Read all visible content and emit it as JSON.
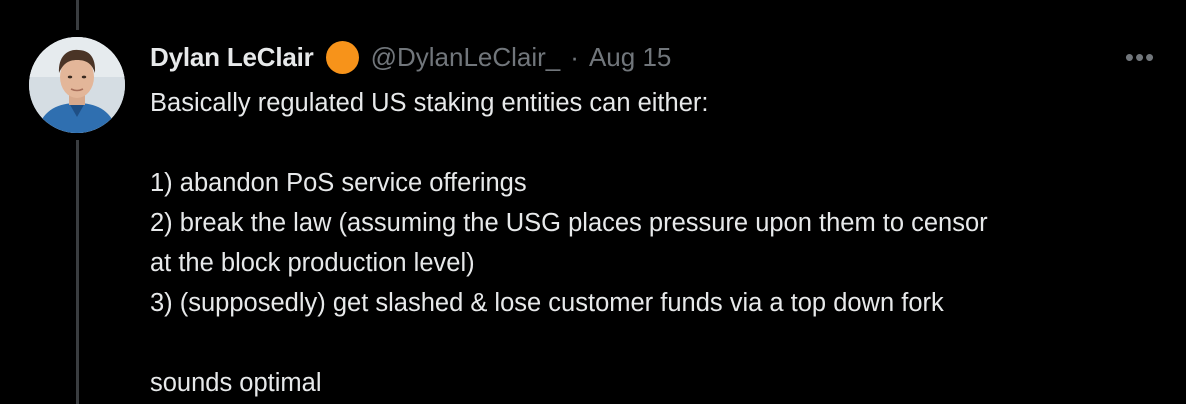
{
  "tweet": {
    "author": {
      "display_name": "Dylan LeClair",
      "handle": "@DylanLeClair_",
      "badge_color": "#f7931a"
    },
    "separator": "·",
    "timestamp": "Aug 15",
    "more_icon": "more-horizontal-icon",
    "more_label": "•••",
    "text": {
      "intro": "Basically regulated US staking entities can either:",
      "item1": "1) abandon PoS service offerings",
      "item2_line1": "2) break the law (assuming the USG places pressure upon them to censor",
      "item2_line2": "at the block production level)",
      "item3": "3) (supposedly) get slashed & lose customer funds via a top down fork",
      "outro": "sounds optimal"
    }
  },
  "colors": {
    "background": "#000000",
    "text_primary": "#e7e9ea",
    "text_secondary": "#71767b",
    "thread_line": "#3a3d40"
  }
}
